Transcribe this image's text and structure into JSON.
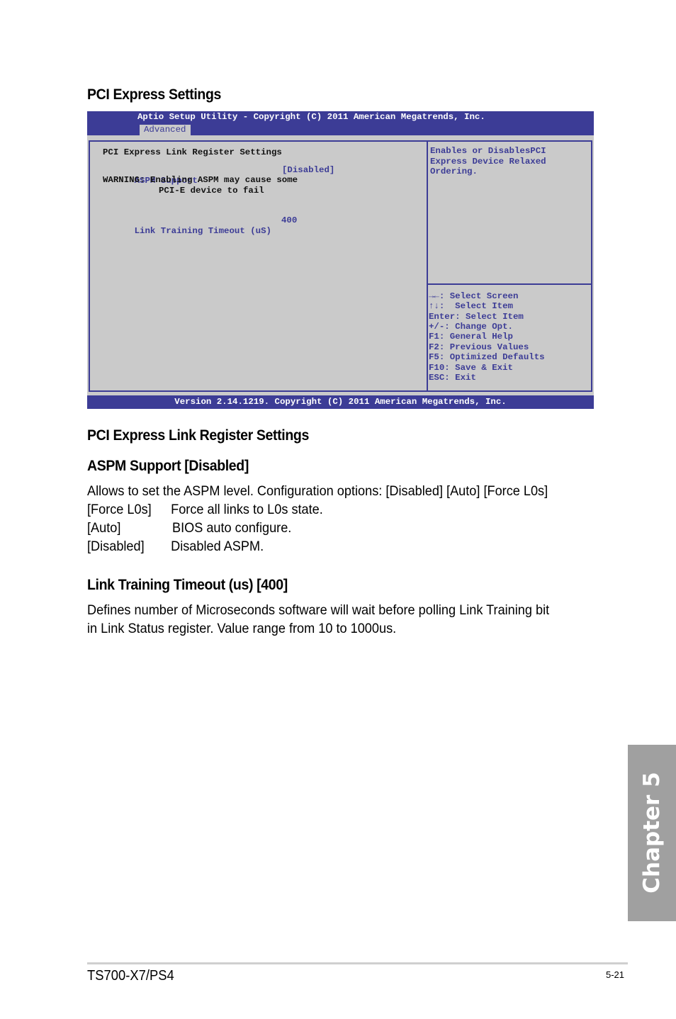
{
  "section_title": "PCI Express Settings",
  "bios": {
    "title": "Aptio Setup Utility - Copyright (C) 2011 American Megatrends, Inc.",
    "active_tab": "Advanced",
    "main": {
      "heading": "PCI Express Link Register Settings",
      "items": [
        {
          "label": "ASPM Support",
          "value": "[Disabled]"
        },
        {
          "label": "Link Training Timeout (uS)",
          "value": "400"
        }
      ],
      "warning_line1": "WARNING: Enabling ASPM may cause some",
      "warning_line2": "PCI-E device to fail"
    },
    "help_text": [
      "Enables or DisablesPCI",
      "Express Device Relaxed",
      "Ordering."
    ],
    "keys": [
      "→←: Select Screen",
      "↑↓:  Select Item",
      "Enter: Select Item",
      "+/-: Change Opt.",
      "F1: General Help",
      "F2: Previous Values",
      "F5: Optimized Defaults",
      "F10: Save & Exit",
      "ESC: Exit"
    ],
    "footer": "Version 2.14.1219. Copyright (C) 2011 American Megatrends, Inc."
  },
  "doc": {
    "subsection_title": "PCI Express Link Register Settings",
    "aspm": {
      "title": "ASPM Support [Disabled]",
      "description": "Allows to set the ASPM level. Configuration options: [Disabled] [Auto] [Force L0s]",
      "options": [
        {
          "key": "[Force L0s]",
          "desc": "Force all links to L0s state."
        },
        {
          "key": "[Auto]",
          "desc": "BIOS auto configure."
        },
        {
          "key": "[Disabled]",
          "desc": "Disabled ASPM."
        }
      ]
    },
    "link_training": {
      "title": "Link Training Timeout (us) [400]",
      "description_line1": "Defines number of Microseconds software will wait before polling Link Training bit",
      "description_line2": "in Link Status register. Value range from 10 to 1000us."
    }
  },
  "chapter_tab": "Chapter 5",
  "footer": {
    "model": "TS700-X7/PS4",
    "page": "5-21"
  }
}
